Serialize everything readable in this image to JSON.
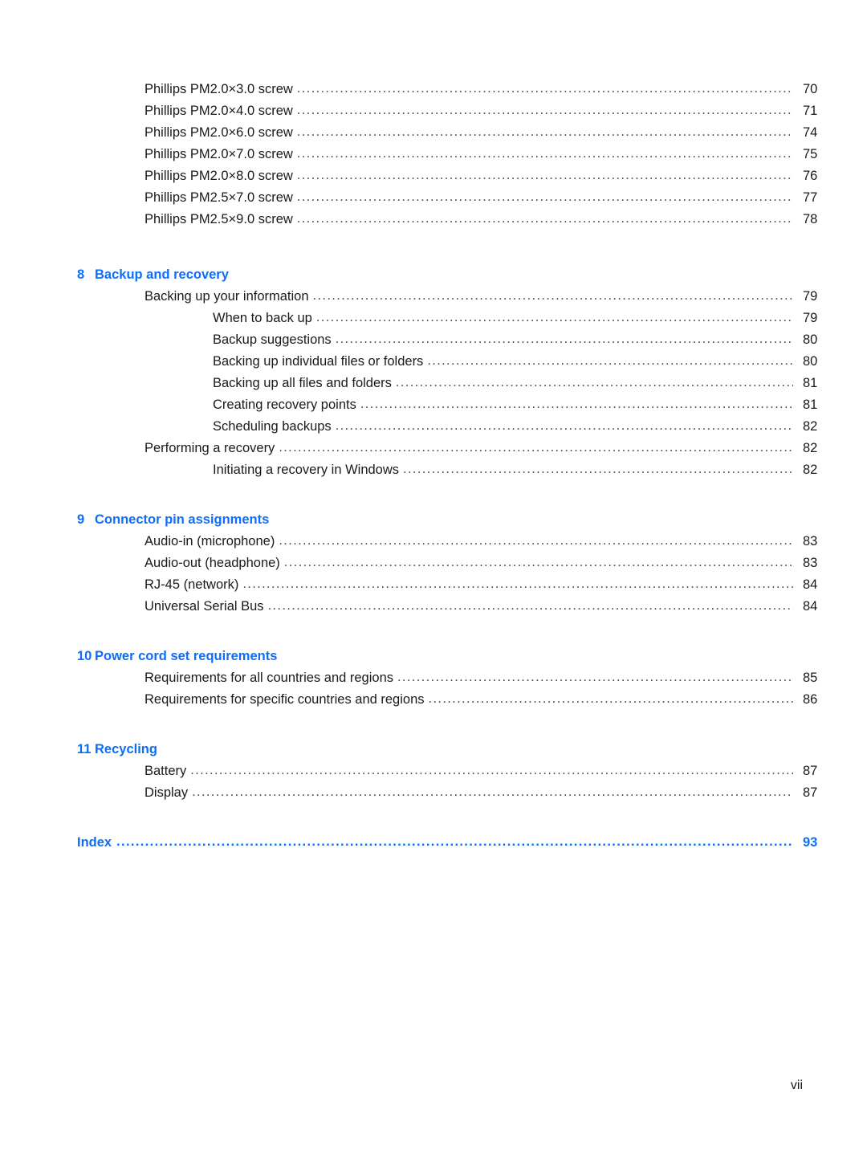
{
  "document": {
    "type": "table-of-contents",
    "footer_page_label": "vii",
    "accent_color": "#0d6ef7",
    "text_color": "#1a1a1a"
  },
  "toc": {
    "orphan_entries": [
      {
        "label": "Phillips PM2.0×3.0 screw",
        "page": "70",
        "level": 1
      },
      {
        "label": "Phillips PM2.0×4.0 screw",
        "page": "71",
        "level": 1
      },
      {
        "label": "Phillips PM2.0×6.0 screw",
        "page": "74",
        "level": 1
      },
      {
        "label": "Phillips PM2.0×7.0 screw",
        "page": "75",
        "level": 1
      },
      {
        "label": "Phillips PM2.0×8.0 screw",
        "page": "76",
        "level": 1
      },
      {
        "label": "Phillips PM2.5×7.0 screw",
        "page": "77",
        "level": 1
      },
      {
        "label": "Phillips PM2.5×9.0 screw",
        "page": "78",
        "level": 1
      }
    ],
    "chapters": [
      {
        "number": "8",
        "title": "Backup and recovery",
        "entries": [
          {
            "label": "Backing up your information",
            "page": "79",
            "level": 1
          },
          {
            "label": "When to back up",
            "page": "79",
            "level": 2
          },
          {
            "label": "Backup suggestions",
            "page": "80",
            "level": 2
          },
          {
            "label": "Backing up individual files or folders",
            "page": "80",
            "level": 2
          },
          {
            "label": "Backing up all files and folders",
            "page": "81",
            "level": 2
          },
          {
            "label": "Creating recovery points",
            "page": "81",
            "level": 2
          },
          {
            "label": "Scheduling backups",
            "page": "82",
            "level": 2
          },
          {
            "label": "Performing a recovery",
            "page": "82",
            "level": 1
          },
          {
            "label": "Initiating a recovery in Windows",
            "page": "82",
            "level": 2
          }
        ]
      },
      {
        "number": "9",
        "title": "Connector pin assignments",
        "entries": [
          {
            "label": "Audio-in (microphone)",
            "page": "83",
            "level": 1
          },
          {
            "label": "Audio-out (headphone)",
            "page": "83",
            "level": 1
          },
          {
            "label": "RJ-45 (network)",
            "page": "84",
            "level": 1
          },
          {
            "label": "Universal Serial Bus",
            "page": "84",
            "level": 1
          }
        ]
      },
      {
        "number": "10",
        "title": "Power cord set requirements",
        "entries": [
          {
            "label": "Requirements for all countries and regions",
            "page": "85",
            "level": 1
          },
          {
            "label": "Requirements for specific countries and regions",
            "page": "86",
            "level": 1
          }
        ]
      },
      {
        "number": "11",
        "title": "Recycling",
        "entries": [
          {
            "label": "Battery",
            "page": "87",
            "level": 1
          },
          {
            "label": "Display",
            "page": "87",
            "level": 1
          }
        ]
      }
    ],
    "index": {
      "label": "Index",
      "page": "93"
    }
  }
}
